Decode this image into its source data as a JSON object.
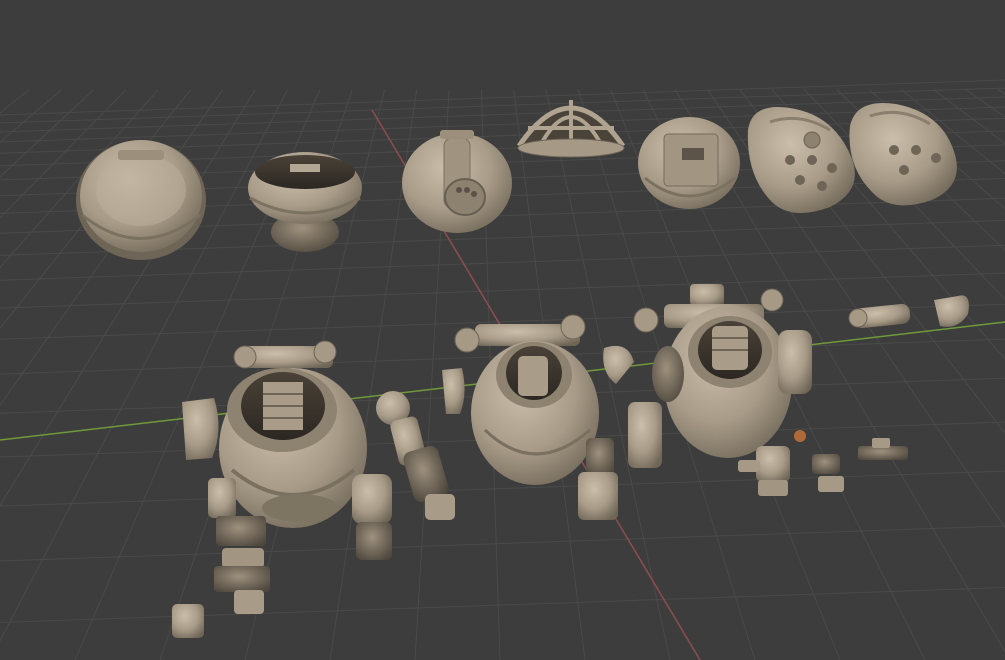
{
  "viewport": {
    "background_color": "#3d3d3d",
    "grid_color": "#4a4a4a",
    "x_axis_color": "#8f4c50",
    "y_axis_color": "#6f9a3a",
    "model_color": "#b2a592"
  },
  "scene": {
    "upper_row": [
      {
        "name": "helmet-dome-shell-part"
      },
      {
        "name": "helmet-neck-ring-part"
      },
      {
        "name": "helmet-porthole-shell-part"
      },
      {
        "name": "helmet-cage-dome-part"
      },
      {
        "name": "helmet-plated-shell-part"
      },
      {
        "name": "helmet-riveted-pod-part"
      },
      {
        "name": "helmet-smooth-pod-part"
      }
    ],
    "lower_row": [
      {
        "name": "robot-exploded-assembly-front"
      },
      {
        "name": "robot-partial-assembly-middle"
      },
      {
        "name": "robot-full-assembly-back"
      }
    ]
  }
}
